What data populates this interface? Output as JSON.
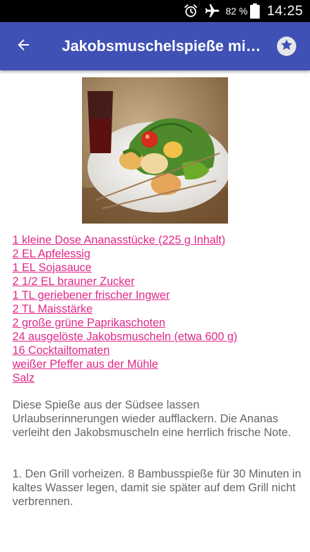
{
  "status_bar": {
    "battery_percent": "82 %",
    "time": "14:25",
    "icons": [
      "alarm-icon",
      "airplane-mode-icon",
      "battery-icon"
    ]
  },
  "app_bar": {
    "title": "Jakobsmuschelspieße mit Ananas",
    "back_icon": "arrow-left-icon",
    "favorite_icon": "star-icon"
  },
  "image": {
    "semantic": "photo of grilled scallop and pineapple skewers with cherry tomatoes and green peppers on a plate, glass of red wine in background"
  },
  "ingredients": [
    "1 kleine Dose Ananasstücke (225 g Inhalt)",
    "2 EL Apfelessig",
    "1 EL Sojasauce",
    "2 1/2 EL brauner Zucker",
    "1 TL geriebener frischer Ingwer",
    "2 TL Maisstärke",
    "2 große grüne Paprikaschoten",
    "24 ausgelöste Jakobsmuscheln (etwa 600 g)",
    "16 Cocktailtomaten",
    "weißer Pfeffer aus der Mühle",
    "Salz"
  ],
  "description": "Diese Spieße aus der Südsee lassen Urlaubserinnerungen wieder aufflackern. Die Ananas verleiht den Jakobsmuscheln eine herrlich frische Note.",
  "step_1": "1. Den Grill vorheizen. 8 Bambusspieße für 30 Minuten in kaltes Wasser legen, damit sie später auf dem Grill nicht verbrennen.",
  "colors": {
    "app_bar": "#3f51b5",
    "link": "#e0288a",
    "body_text": "#666666",
    "status_bar": "#000000"
  }
}
